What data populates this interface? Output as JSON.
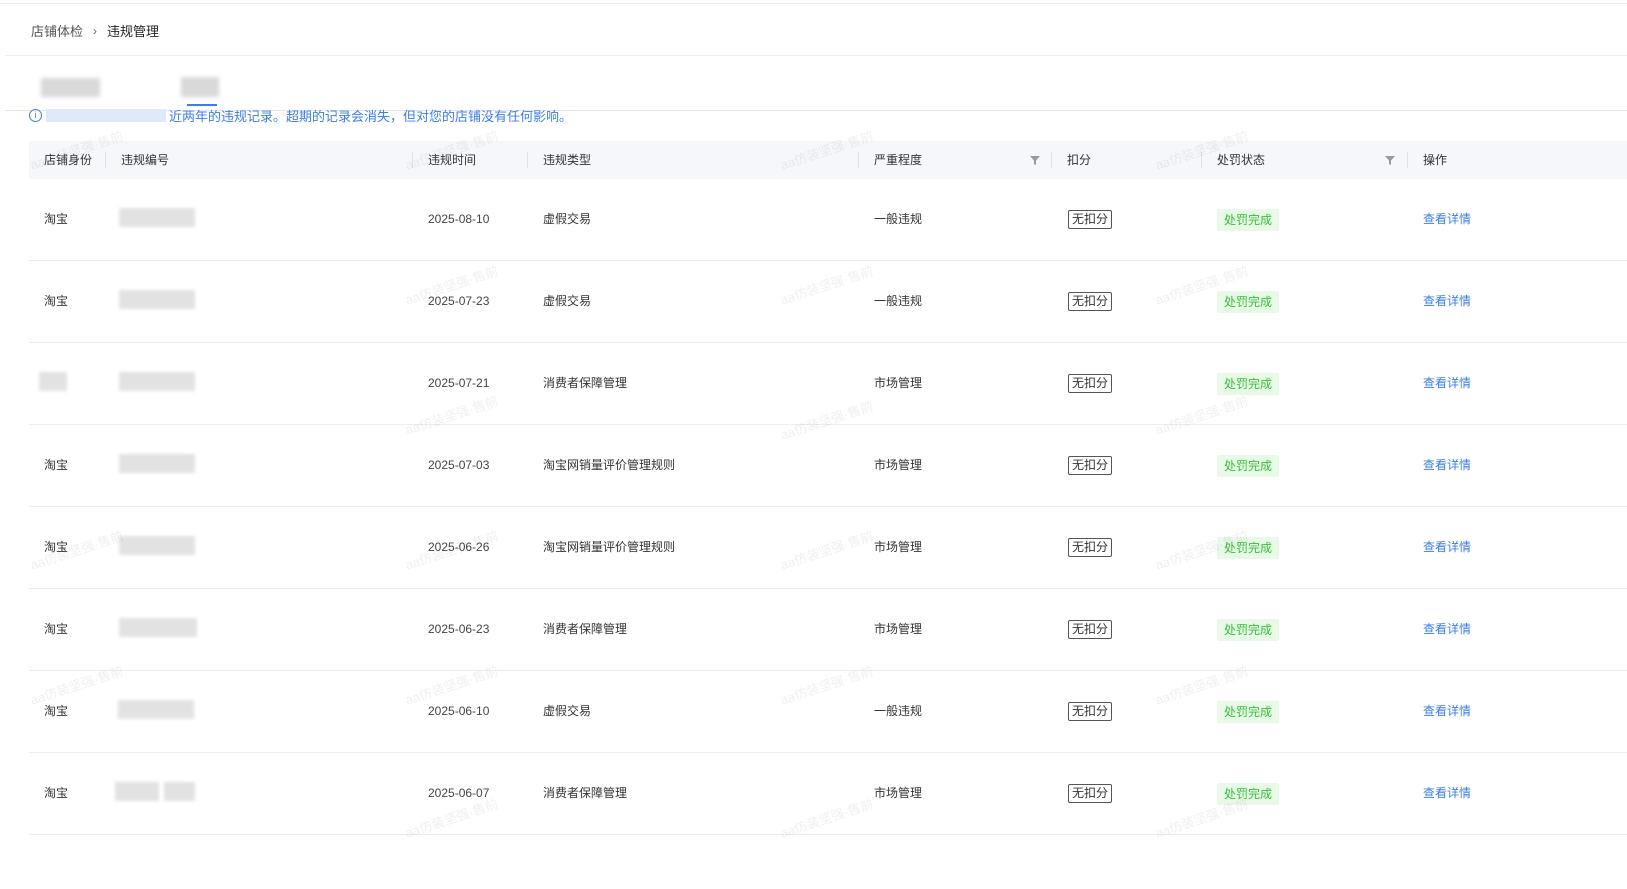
{
  "breadcrumb": {
    "parent": "店铺体检",
    "separator": "›",
    "current": "违规管理"
  },
  "notice": {
    "icon": "info-icon",
    "text": "近两年的违规记录。超期的记录会消失，但对您的店铺没有任何影响。"
  },
  "table": {
    "headers": {
      "identity": "店铺身份",
      "id": "违规编号",
      "time": "违规时间",
      "type": "违规类型",
      "severity": "严重程度",
      "deduct": "扣分",
      "status": "处罚状态",
      "action": "操作"
    },
    "rows": [
      {
        "identity": "淘宝",
        "time": "2025-08-10",
        "type": "虚假交易",
        "severity": "一般违规",
        "deduct": "无扣分",
        "status": "处罚完成",
        "action": "查看详情"
      },
      {
        "identity": "淘宝",
        "time": "2025-07-23",
        "type": "虚假交易",
        "severity": "一般违规",
        "deduct": "无扣分",
        "status": "处罚完成",
        "action": "查看详情"
      },
      {
        "identity": "",
        "time": "2025-07-21",
        "type": "消费者保障管理",
        "severity": "市场管理",
        "deduct": "无扣分",
        "status": "处罚完成",
        "action": "查看详情"
      },
      {
        "identity": "淘宝",
        "time": "2025-07-03",
        "type": "淘宝网销量评价管理规则",
        "severity": "市场管理",
        "deduct": "无扣分",
        "status": "处罚完成",
        "action": "查看详情"
      },
      {
        "identity": "淘宝",
        "time": "2025-06-26",
        "type": "淘宝网销量评价管理规则",
        "severity": "市场管理",
        "deduct": "无扣分",
        "status": "处罚完成",
        "action": "查看详情"
      },
      {
        "identity": "淘宝",
        "time": "2025-06-23",
        "type": "消费者保障管理",
        "severity": "市场管理",
        "deduct": "无扣分",
        "status": "处罚完成",
        "action": "查看详情"
      },
      {
        "identity": "淘宝",
        "time": "2025-06-10",
        "type": "虚假交易",
        "severity": "一般违规",
        "deduct": "无扣分",
        "status": "处罚完成",
        "action": "查看详情"
      },
      {
        "identity": "淘宝",
        "time": "2025-06-07",
        "type": "消费者保障管理",
        "severity": "市场管理",
        "deduct": "无扣分",
        "status": "处罚完成",
        "action": "查看详情"
      }
    ]
  },
  "watermark": "aa仿装坚强·售前",
  "colors": {
    "link": "#3b7ee6",
    "status_text": "#37c037",
    "status_bg": "#e8f9e8",
    "header_bg": "#f5f7fa"
  }
}
